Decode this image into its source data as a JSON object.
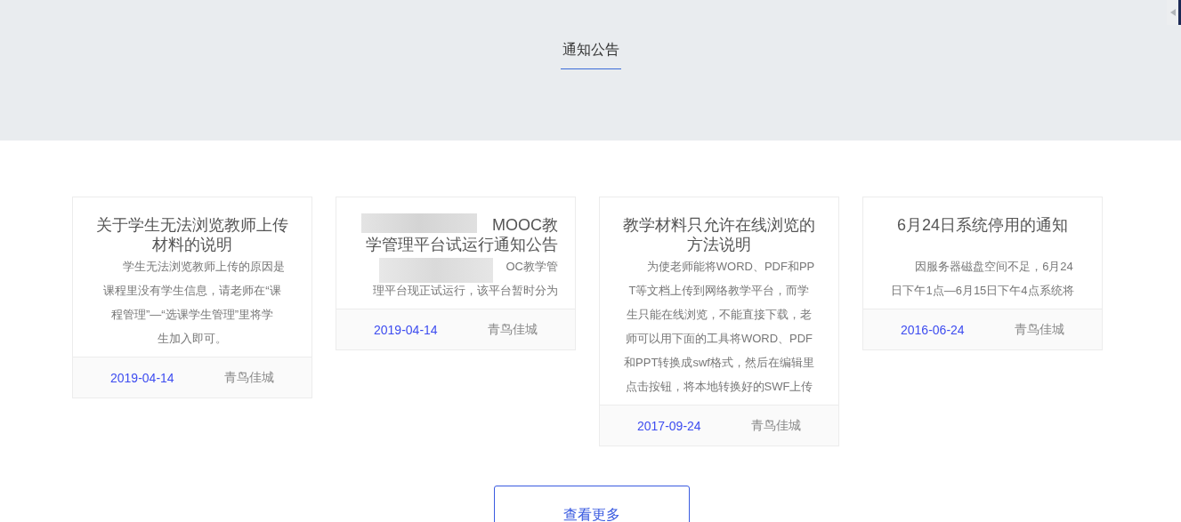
{
  "header": {
    "title": "通知公告"
  },
  "notices": [
    {
      "title_lines": [
        "关于学生无法浏览教师上传",
        "材料的说明"
      ],
      "body_lines": [
        "学生无法浏览教师上传的原因是",
        "课程里没有学生信息，请老师在“课",
        "程管理”—“选课学生管理”里将学",
        "生加入即可。"
      ],
      "date": "2019-04-14",
      "author": "青鸟佳城",
      "redacted": false
    },
    {
      "title_lines": [
        "MOOC教",
        "学管理平台试运行通知公告"
      ],
      "body_lines": [
        "OC教学管",
        "理平台现正试运行，该平台暂时分为"
      ],
      "date": "2019-04-14",
      "author": "青鸟佳城",
      "redacted": true
    },
    {
      "title_lines": [
        "教学材料只允许在线浏览的",
        "方法说明"
      ],
      "body_lines": [
        "为使老师能将WORD、PDF和PP",
        "T等文档上传到网络教学平台，而学",
        "生只能在线浏览，不能直接下载，老",
        "师可以用下面的工具将WORD、PDF",
        "和PPT转换成swf格式，然后在编辑里",
        "点击按钮，将本地转换好的SWF上传"
      ],
      "date": "2017-09-24",
      "author": "青鸟佳城",
      "redacted": false
    },
    {
      "title_lines": [
        "6月24日系统停用的通知"
      ],
      "body_lines": [
        "因服务器磁盘空间不足，6月24",
        "日下午1点—6月15日下午4点系统将"
      ],
      "date": "2016-06-24",
      "author": "青鸟佳城",
      "redacted": false
    }
  ],
  "more_button": {
    "label": "查看更多"
  }
}
